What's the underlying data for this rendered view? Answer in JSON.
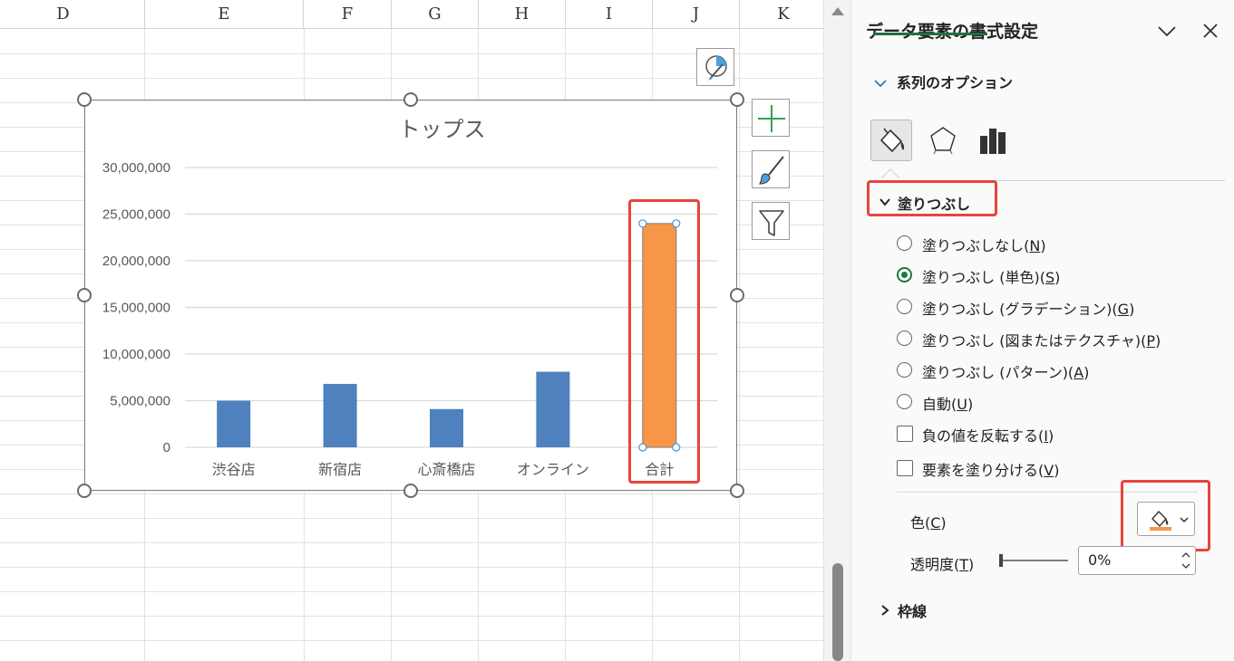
{
  "sheet": {
    "columns": [
      "D",
      "E",
      "F",
      "G",
      "H",
      "I",
      "J",
      "K"
    ]
  },
  "chart_data": {
    "type": "bar",
    "title": "トップス",
    "categories": [
      "渋谷店",
      "新宿店",
      "心斎橋店",
      "オンライン",
      "合計"
    ],
    "values": [
      5000000,
      6800000,
      4100000,
      8100000,
      24000000
    ],
    "y_tick_labels": [
      "30,000,000",
      "25,000,000",
      "20,000,000",
      "15,000,000",
      "10,000,000",
      "5,000,000",
      "0"
    ],
    "ylim": [
      0,
      30000000
    ],
    "ytick_step": 5000000,
    "grid": true,
    "bar_color": "#4e81bd",
    "highlight_color": "#f79646",
    "highlight_index": 4
  },
  "chart_tools": {
    "elements_icon": "plus-icon",
    "styles_icon": "brush-icon",
    "filter_icon": "filter-icon",
    "quick_layout_icon": "chart-layout-icon"
  },
  "pane": {
    "title": "データ要素の書式設定",
    "series_tab": "系列のオプション",
    "fill_section": "塗りつぶし",
    "options": [
      {
        "label": "塗りつぶしなし(",
        "key": "N",
        "end": ")",
        "selected": false
      },
      {
        "label": "塗りつぶし (単色)(",
        "key": "S",
        "end": ")",
        "selected": true
      },
      {
        "label": "塗りつぶし (グラデーション)(",
        "key": "G",
        "end": ")",
        "selected": false
      },
      {
        "label": "塗りつぶし (図またはテクスチャ)(",
        "key": "P",
        "end": ")",
        "selected": false
      },
      {
        "label": "塗りつぶし (パターン)(",
        "key": "A",
        "end": ")",
        "selected": false
      },
      {
        "label": "自動(",
        "key": "U",
        "end": ")",
        "selected": false
      }
    ],
    "checks": [
      {
        "label": "負の値を反転する(",
        "key": "I",
        "end": ")"
      },
      {
        "label": "要素を塗り分ける(",
        "key": "V",
        "end": ")"
      }
    ],
    "color_label": {
      "label": "色(",
      "key": "C",
      "end": ")"
    },
    "transparency_label": {
      "label": "透明度(",
      "key": "T",
      "end": ")"
    },
    "transparency_value": "0%",
    "border_section": "枠線",
    "accent_color": "#1f6f43",
    "selected_fill_color": "#f79646"
  }
}
